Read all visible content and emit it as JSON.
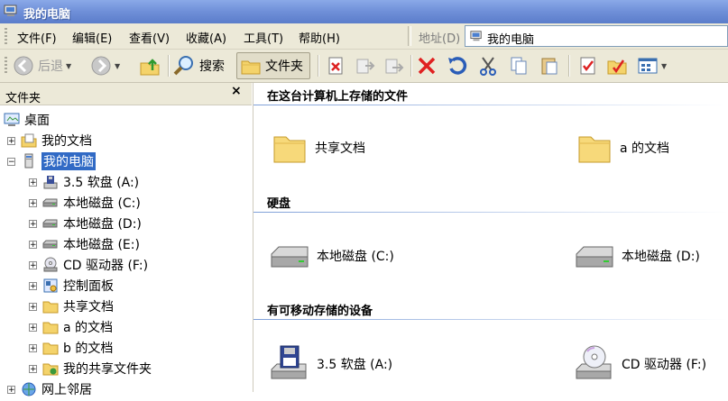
{
  "window": {
    "title": "我的电脑"
  },
  "menu": {
    "items": [
      {
        "label": "文件(F)"
      },
      {
        "label": "编辑(E)"
      },
      {
        "label": "查看(V)"
      },
      {
        "label": "收藏(A)"
      },
      {
        "label": "工具(T)"
      },
      {
        "label": "帮助(H)"
      }
    ],
    "address_label": "地址(D)",
    "address_value": "我的电脑"
  },
  "toolbar": {
    "back_label": "后退",
    "search_label": "搜索",
    "folders_label": "文件夹"
  },
  "left_pane": {
    "header": "文件夹",
    "close_glyph": "×",
    "tree": [
      {
        "label": "桌面",
        "icon": "desktop-icon"
      },
      {
        "label": "我的文档",
        "icon": "my-documents-icon"
      },
      {
        "label": "我的电脑",
        "icon": "my-computer-icon"
      },
      {
        "label": "3.5 软盘 (A:)",
        "icon": "floppy-icon"
      },
      {
        "label": "本地磁盘 (C:)",
        "icon": "hard-disk-icon"
      },
      {
        "label": "本地磁盘 (D:)",
        "icon": "hard-disk-icon"
      },
      {
        "label": "本地磁盘 (E:)",
        "icon": "hard-disk-icon"
      },
      {
        "label": "CD 驱动器 (F:)",
        "icon": "cd-drive-icon"
      },
      {
        "label": "控制面板",
        "icon": "control-panel-icon"
      },
      {
        "label": "共享文档",
        "icon": "folder-icon"
      },
      {
        "label": "a 的文档",
        "icon": "folder-icon"
      },
      {
        "label": "b 的文档",
        "icon": "folder-icon"
      },
      {
        "label": "我的共享文件夹",
        "icon": "shared-folder-icon"
      },
      {
        "label": "网上邻居",
        "icon": "network-icon"
      }
    ]
  },
  "right_pane": {
    "groups": [
      {
        "title": "在这台计算机上存储的文件",
        "items": [
          {
            "label": "共享文档"
          },
          {
            "label": "a 的文档"
          }
        ]
      },
      {
        "title": "硬盘",
        "items": [
          {
            "label": "本地磁盘 (C:)"
          },
          {
            "label": "本地磁盘 (D:)"
          }
        ]
      },
      {
        "title": "有可移动存储的设备",
        "items": [
          {
            "label": "3.5 软盘 (A:)"
          },
          {
            "label": "CD 驱动器 (F:)"
          }
        ]
      }
    ]
  },
  "colors": {
    "selection": "#316ac5",
    "toolbar_bg": "#ece9d8",
    "title_bar": "#6f8fd8"
  }
}
